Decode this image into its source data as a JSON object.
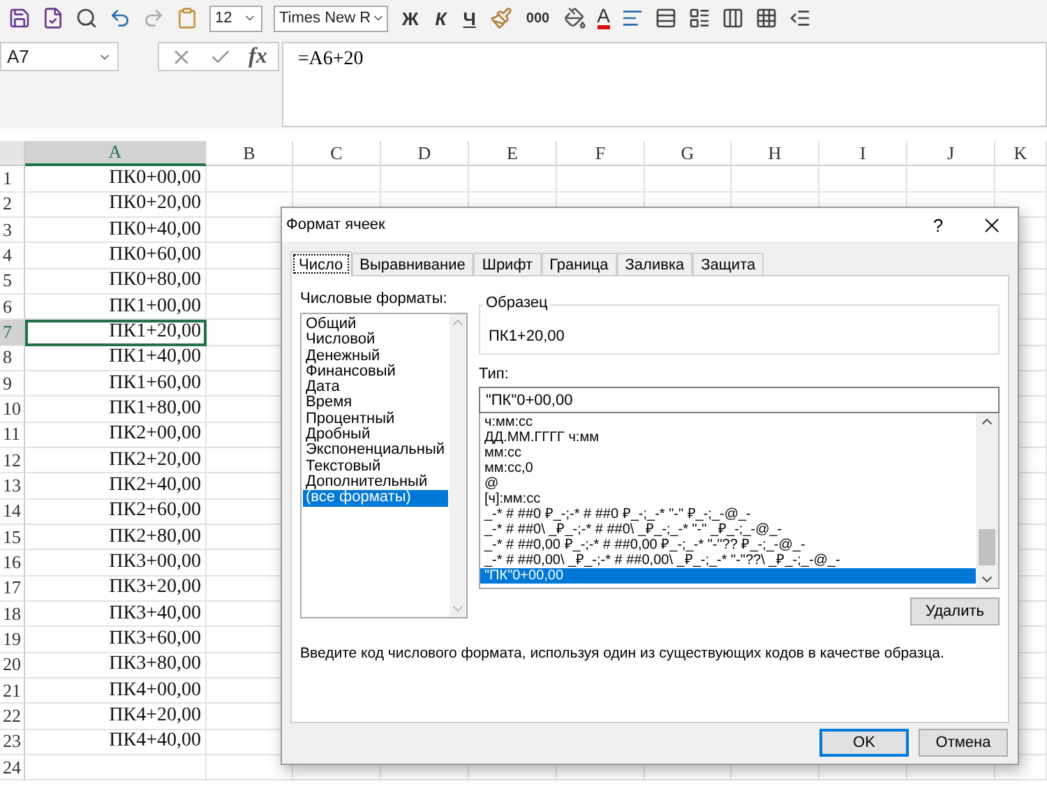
{
  "toolbar": {
    "font_size": "12",
    "font_name": "Times New R",
    "style_buttons": [
      "Ж",
      "К",
      "Ч"
    ],
    "thousands_button": "000",
    "font_color_button": "A"
  },
  "formula_bar": {
    "name_box": "A7",
    "function_label": "fx",
    "formula": "=A6+20"
  },
  "sheet": {
    "columns": [
      {
        "label": "A",
        "selected": true
      },
      {
        "label": "B",
        "selected": false
      },
      {
        "label": "C",
        "selected": false
      },
      {
        "label": "D",
        "selected": false
      },
      {
        "label": "E",
        "selected": false
      },
      {
        "label": "F",
        "selected": false
      },
      {
        "label": "G",
        "selected": false
      },
      {
        "label": "H",
        "selected": false
      },
      {
        "label": "I",
        "selected": false
      },
      {
        "label": "J",
        "selected": false
      },
      {
        "label": "K",
        "selected": false
      }
    ],
    "rows": [
      {
        "number": "1",
        "value": "ПК0+00,00",
        "selected": false
      },
      {
        "number": "2",
        "value": "ПК0+20,00",
        "selected": false
      },
      {
        "number": "3",
        "value": "ПК0+40,00",
        "selected": false
      },
      {
        "number": "4",
        "value": "ПК0+60,00",
        "selected": false
      },
      {
        "number": "5",
        "value": "ПК0+80,00",
        "selected": false
      },
      {
        "number": "6",
        "value": "ПК1+00,00",
        "selected": false
      },
      {
        "number": "7",
        "value": "ПК1+20,00",
        "selected": true
      },
      {
        "number": "8",
        "value": "ПК1+40,00",
        "selected": false
      },
      {
        "number": "9",
        "value": "ПК1+60,00",
        "selected": false
      },
      {
        "number": "10",
        "value": "ПК1+80,00",
        "selected": false
      },
      {
        "number": "11",
        "value": "ПК2+00,00",
        "selected": false
      },
      {
        "number": "12",
        "value": "ПК2+20,00",
        "selected": false
      },
      {
        "number": "13",
        "value": "ПК2+40,00",
        "selected": false
      },
      {
        "number": "14",
        "value": "ПК2+60,00",
        "selected": false
      },
      {
        "number": "15",
        "value": "ПК2+80,00",
        "selected": false
      },
      {
        "number": "16",
        "value": "ПК3+00,00",
        "selected": false
      },
      {
        "number": "17",
        "value": "ПК3+20,00",
        "selected": false
      },
      {
        "number": "18",
        "value": "ПК3+40,00",
        "selected": false
      },
      {
        "number": "19",
        "value": "ПК3+60,00",
        "selected": false
      },
      {
        "number": "20",
        "value": "ПК3+80,00",
        "selected": false
      },
      {
        "number": "21",
        "value": "ПК4+00,00",
        "selected": false
      },
      {
        "number": "22",
        "value": "ПК4+20,00",
        "selected": false
      },
      {
        "number": "23",
        "value": "ПК4+40,00",
        "selected": false
      },
      {
        "number": "24",
        "selected": false
      }
    ]
  },
  "dialog": {
    "title": "Формат ячеек",
    "help": "?",
    "tabs": [
      {
        "label": "Число",
        "selected": true
      },
      {
        "label": "Выравнивание",
        "selected": false
      },
      {
        "label": "Шрифт",
        "selected": false
      },
      {
        "label": "Граница",
        "selected": false
      },
      {
        "label": "Заливка",
        "selected": false
      },
      {
        "label": "Защита",
        "selected": false
      }
    ],
    "categories_label": "Числовые форматы:",
    "categories": [
      {
        "label": "Общий",
        "selected": false
      },
      {
        "label": "Числовой",
        "selected": false
      },
      {
        "label": "Денежный",
        "selected": false
      },
      {
        "label": "Финансовый",
        "selected": false
      },
      {
        "label": "Дата",
        "selected": false
      },
      {
        "label": "Время",
        "selected": false
      },
      {
        "label": "Процентный",
        "selected": false
      },
      {
        "label": "Дробный",
        "selected": false
      },
      {
        "label": "Экспоненциальный",
        "selected": false
      },
      {
        "label": "Текстовый",
        "selected": false
      },
      {
        "label": "Дополнительный",
        "selected": false
      },
      {
        "label": "(все форматы)",
        "selected": true
      }
    ],
    "sample_label": "Образец",
    "sample_value": "ПК1+20,00",
    "type_label": "Тип:",
    "type_value": "\"ПК\"0+00,00",
    "formats": [
      {
        "label": "ч:мм:сс",
        "selected": false
      },
      {
        "label": "ДД.ММ.ГГГГ ч:мм",
        "selected": false
      },
      {
        "label": "мм:сс",
        "selected": false
      },
      {
        "label": "мм:сс,0",
        "selected": false
      },
      {
        "label": "@",
        "selected": false
      },
      {
        "label": "[ч]:мм:сс",
        "selected": false
      },
      {
        "label": "_-* # ##0 ₽_-;-* # ##0 ₽_-;_-* \"-\" ₽_-;_-@_-",
        "selected": false
      },
      {
        "label": "_-* # ##0\\ _₽_-;-* # ##0\\ _₽_-;_-* \"-\" _₽_-;_-@_-",
        "selected": false
      },
      {
        "label": "_-* # ##0,00 ₽_-;-* # ##0,00 ₽_-;_-* \"-\"?? ₽_-;_-@_-",
        "selected": false
      },
      {
        "label": "_-* # ##0,00\\ _₽_-;-* # ##0,00\\ _₽_-;_-* \"-\"??\\ _₽_-;_-@_-",
        "selected": false
      },
      {
        "label": "\"ПК\"0+00,00",
        "selected": true
      }
    ],
    "delete_button": "Удалить",
    "description": "Введите код числового формата, используя один из существующих кодов в качестве образца.",
    "buttons": [
      "OK",
      "Отмена"
    ]
  }
}
